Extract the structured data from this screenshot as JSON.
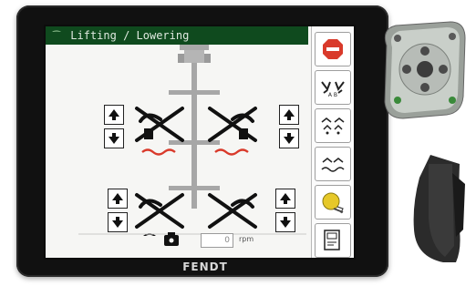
{
  "screen": {
    "title": "Lifting / Lowering",
    "title_icon": "hitch-icon"
  },
  "side_buttons": [
    {
      "name": "stop-button",
      "icon": "stop-icon",
      "color": "#d93a2b"
    },
    {
      "name": "front-rear-hitch-button",
      "icon": "hitch-pair-icon"
    },
    {
      "name": "raise-lower-mode-button",
      "icon": "raise-lower-icon"
    },
    {
      "name": "float-mode-button",
      "icon": "float-icon"
    },
    {
      "name": "headland-button",
      "icon": "headland-icon",
      "color": "#e6c829"
    },
    {
      "name": "page-button",
      "icon": "page-icon"
    }
  ],
  "bottom": {
    "rpm_value": "0",
    "rpm_unit": "rpm"
  },
  "brand": "FENDT",
  "colors": {
    "title_bar": "#0f4a1e",
    "accent_red": "#d93a2b",
    "screen_bg": "#f6f6f4"
  }
}
